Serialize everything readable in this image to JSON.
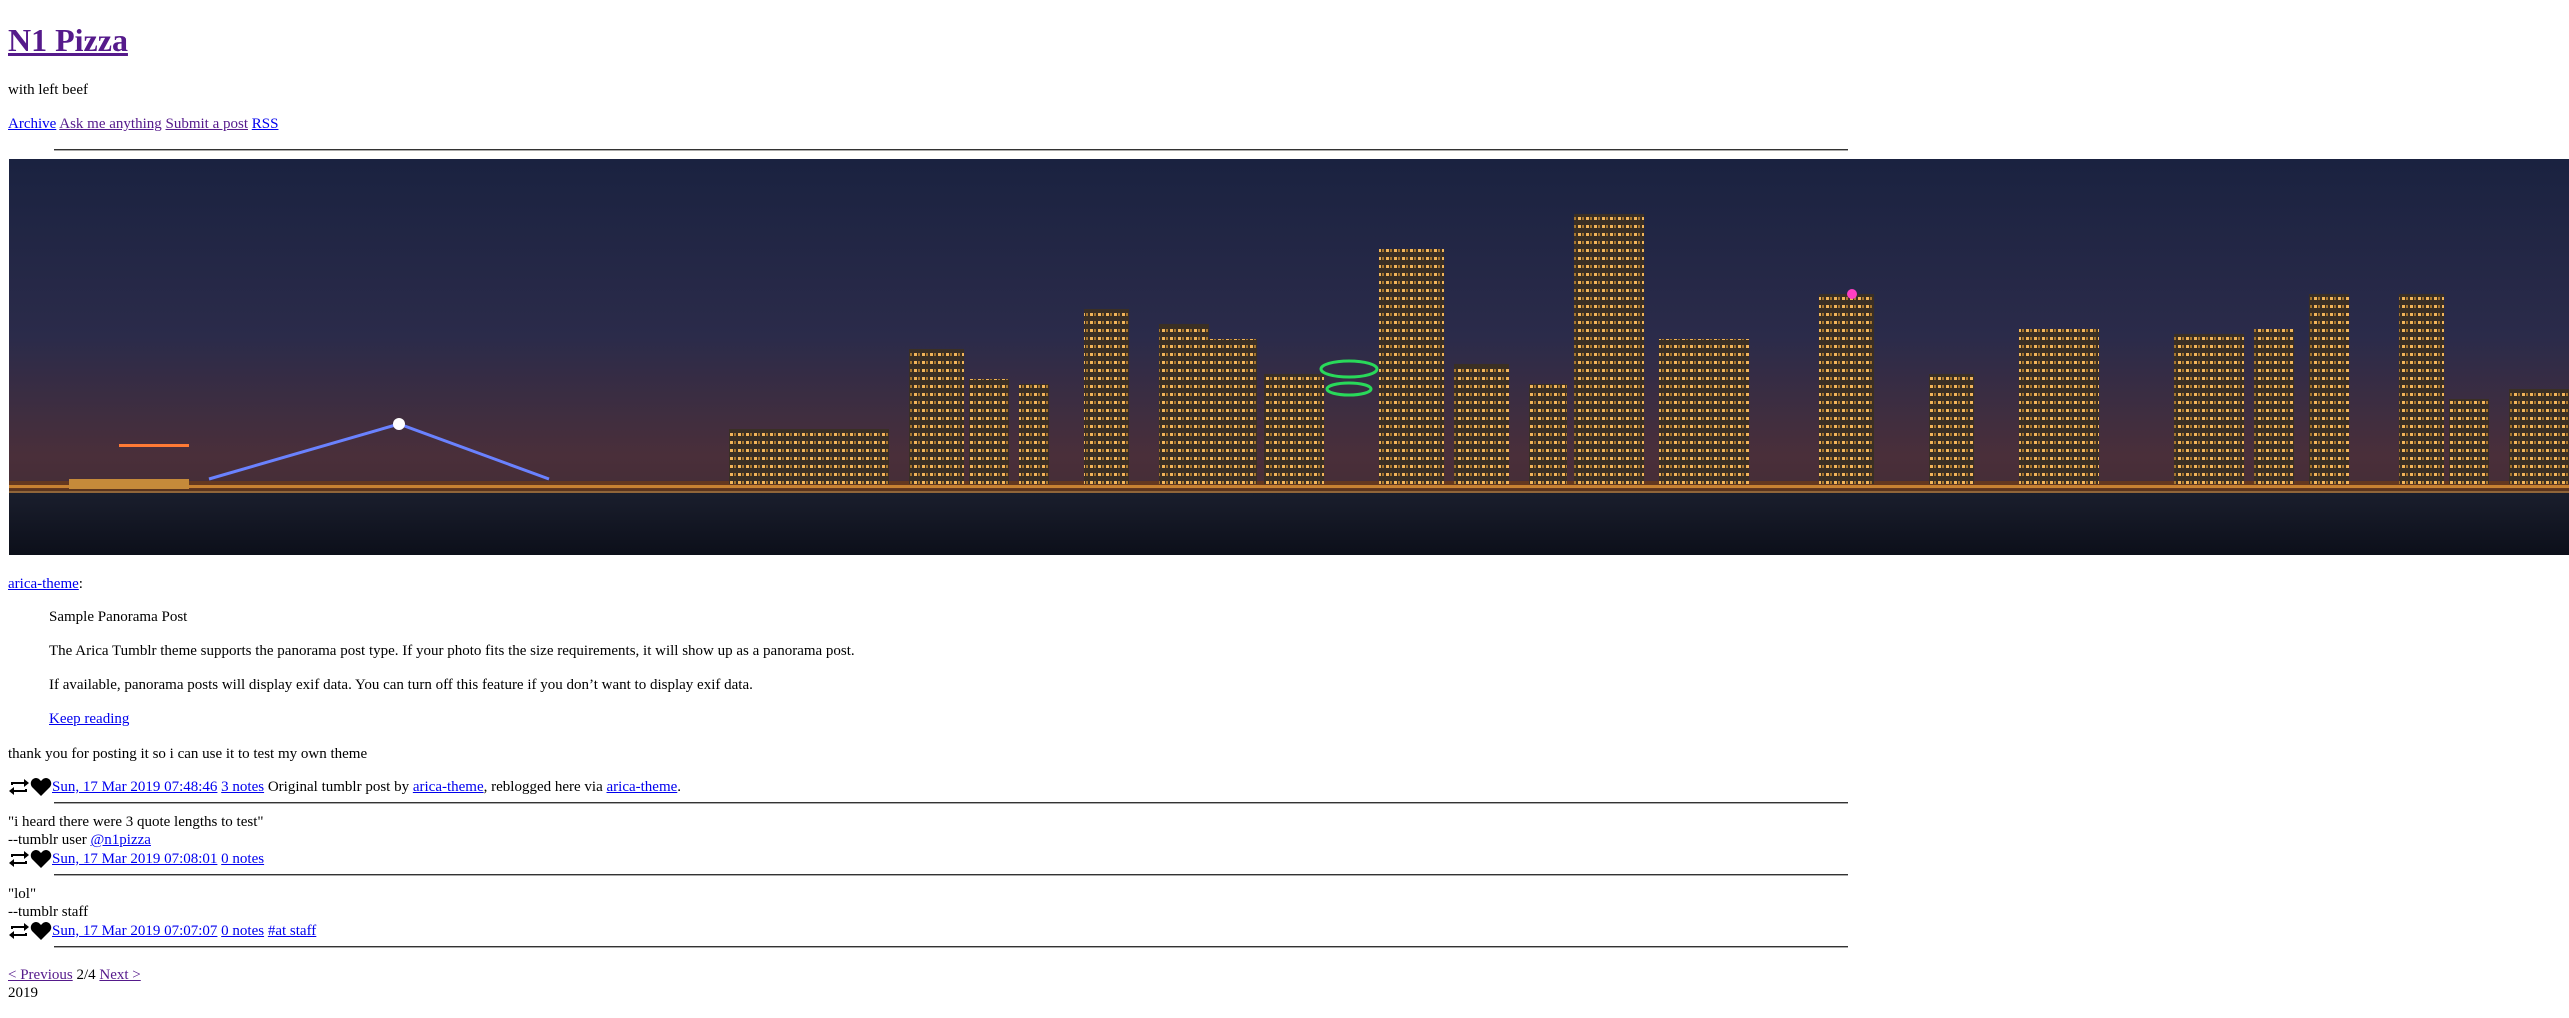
{
  "site": {
    "title": "N1 Pizza",
    "tagline": "with left beef"
  },
  "nav": [
    "Archive",
    "Ask me anything",
    "Submit a post",
    "RSS"
  ],
  "posts": [
    {
      "author_link": "arica-theme",
      "author_suffix": ":",
      "quote": {
        "heading": "Sample Panorama Post",
        "p1": "The Arica Tumblr theme supports the panorama post type. If your photo fits the size requirements, it will show up as a panorama post.",
        "p2": "If available, panorama posts will display exif data. You can turn off this feature if you don’t want to display exif data.",
        "keep_reading": "Keep reading"
      },
      "comment": "thank you for posting it so i can use it to test my own theme",
      "footer": {
        "date": "Sun, 17 Mar 2019 07:48:46",
        "notes": "3 notes",
        "text1": "Original tumblr post by",
        "source": "arica-theme",
        "text2": ", reblogged here via",
        "via": "arica-theme",
        "text3": "."
      }
    },
    {
      "quote": "\"i heard there were 3 quote lengths to test\"",
      "attribution_prefix": "--tumblr user",
      "attribution_link": "@n1pizza",
      "footer": {
        "date": "Sun, 17 Mar 2019 07:08:01",
        "notes": "0 notes"
      }
    },
    {
      "quote": "\"lol\"",
      "attribution_prefix": "--tumblr staff",
      "footer": {
        "date": "Sun, 17 Mar 2019 07:07:07",
        "notes": "0 notes",
        "tag": "#at staff"
      }
    }
  ],
  "pagination": {
    "previous": "< Previous",
    "current": "2/4",
    "next": "Next >"
  },
  "year": "2019",
  "colors": {
    "link": "#0000ee",
    "visited": "#551a8b"
  },
  "icons": [
    "reblog-icon",
    "heart-icon"
  ]
}
